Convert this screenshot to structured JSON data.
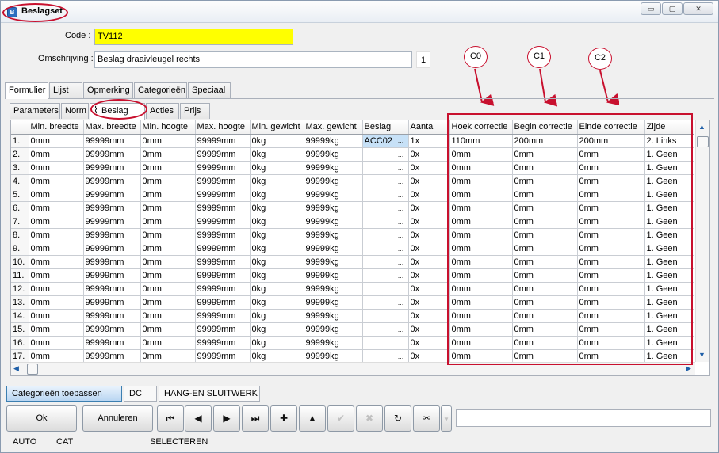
{
  "window": {
    "title": "Beslagset",
    "controls": {
      "minimize": "▭",
      "maximize": "▢",
      "close": "✕"
    }
  },
  "form": {
    "code_label": "Code :",
    "code_value": "TV112",
    "omschrijving_label": "Omschrijving :",
    "omschrijving_value": "Beslag draaivleugel rechts",
    "line_count": "1"
  },
  "main_tabs": [
    "Formulier",
    "Lijst",
    "Opmerking",
    "Categorieën",
    "Speciaal"
  ],
  "sub_tabs": [
    "Parameters",
    "Norm",
    "Beslag",
    "Acties",
    "Prijs"
  ],
  "annotations": [
    "C0",
    "C1",
    "C2"
  ],
  "grid": {
    "columns": [
      "",
      "Min. breedte",
      "Max. breedte",
      "Min. hoogte",
      "Max. hoogte",
      "Min. gewicht",
      "Max. gewicht",
      "Beslag",
      "Aantal",
      "Hoek correctie",
      "Begin correctie",
      "Einde correctie",
      "Zijde"
    ],
    "rows": [
      [
        "1.",
        "0mm",
        "99999mm",
        "0mm",
        "99999mm",
        "0kg",
        "99999kg",
        "ACC02",
        "1x",
        "110mm",
        "200mm",
        "200mm",
        "2. Links"
      ],
      [
        "2.",
        "0mm",
        "99999mm",
        "0mm",
        "99999mm",
        "0kg",
        "99999kg",
        "",
        "0x",
        "0mm",
        "0mm",
        "0mm",
        "1. Geen"
      ],
      [
        "3.",
        "0mm",
        "99999mm",
        "0mm",
        "99999mm",
        "0kg",
        "99999kg",
        "",
        "0x",
        "0mm",
        "0mm",
        "0mm",
        "1. Geen"
      ],
      [
        "4.",
        "0mm",
        "99999mm",
        "0mm",
        "99999mm",
        "0kg",
        "99999kg",
        "",
        "0x",
        "0mm",
        "0mm",
        "0mm",
        "1. Geen"
      ],
      [
        "5.",
        "0mm",
        "99999mm",
        "0mm",
        "99999mm",
        "0kg",
        "99999kg",
        "",
        "0x",
        "0mm",
        "0mm",
        "0mm",
        "1. Geen"
      ],
      [
        "6.",
        "0mm",
        "99999mm",
        "0mm",
        "99999mm",
        "0kg",
        "99999kg",
        "",
        "0x",
        "0mm",
        "0mm",
        "0mm",
        "1. Geen"
      ],
      [
        "7.",
        "0mm",
        "99999mm",
        "0mm",
        "99999mm",
        "0kg",
        "99999kg",
        "",
        "0x",
        "0mm",
        "0mm",
        "0mm",
        "1. Geen"
      ],
      [
        "8.",
        "0mm",
        "99999mm",
        "0mm",
        "99999mm",
        "0kg",
        "99999kg",
        "",
        "0x",
        "0mm",
        "0mm",
        "0mm",
        "1. Geen"
      ],
      [
        "9.",
        "0mm",
        "99999mm",
        "0mm",
        "99999mm",
        "0kg",
        "99999kg",
        "",
        "0x",
        "0mm",
        "0mm",
        "0mm",
        "1. Geen"
      ],
      [
        "10.",
        "0mm",
        "99999mm",
        "0mm",
        "99999mm",
        "0kg",
        "99999kg",
        "",
        "0x",
        "0mm",
        "0mm",
        "0mm",
        "1. Geen"
      ],
      [
        "11.",
        "0mm",
        "99999mm",
        "0mm",
        "99999mm",
        "0kg",
        "99999kg",
        "",
        "0x",
        "0mm",
        "0mm",
        "0mm",
        "1. Geen"
      ],
      [
        "12.",
        "0mm",
        "99999mm",
        "0mm",
        "99999mm",
        "0kg",
        "99999kg",
        "",
        "0x",
        "0mm",
        "0mm",
        "0mm",
        "1. Geen"
      ],
      [
        "13.",
        "0mm",
        "99999mm",
        "0mm",
        "99999mm",
        "0kg",
        "99999kg",
        "",
        "0x",
        "0mm",
        "0mm",
        "0mm",
        "1. Geen"
      ],
      [
        "14.",
        "0mm",
        "99999mm",
        "0mm",
        "99999mm",
        "0kg",
        "99999kg",
        "",
        "0x",
        "0mm",
        "0mm",
        "0mm",
        "1. Geen"
      ],
      [
        "15.",
        "0mm",
        "99999mm",
        "0mm",
        "99999mm",
        "0kg",
        "99999kg",
        "",
        "0x",
        "0mm",
        "0mm",
        "0mm",
        "1. Geen"
      ],
      [
        "16.",
        "0mm",
        "99999mm",
        "0mm",
        "99999mm",
        "0kg",
        "99999kg",
        "",
        "0x",
        "0mm",
        "0mm",
        "0mm",
        "1. Geen"
      ],
      [
        "17.",
        "0mm",
        "99999mm",
        "0mm",
        "99999mm",
        "0kg",
        "99999kg",
        "",
        "0x",
        "0mm",
        "0mm",
        "0mm",
        "1. Geen"
      ]
    ],
    "ellipsis": "..."
  },
  "bottom_bar": {
    "apply_button": "Categorieën toepassen",
    "code_chip": "DC",
    "name_chip": "HANG-EN SLUITWERK"
  },
  "actions": {
    "ok": "Ok",
    "cancel": "Annuleren"
  },
  "status_bar": [
    "AUTO",
    "CAT",
    "SELECTEREN"
  ],
  "colors": {
    "highlight_yellow": "#ffff00",
    "annotation_red": "#c8102e",
    "selected_cell": "#c7e1f7"
  }
}
